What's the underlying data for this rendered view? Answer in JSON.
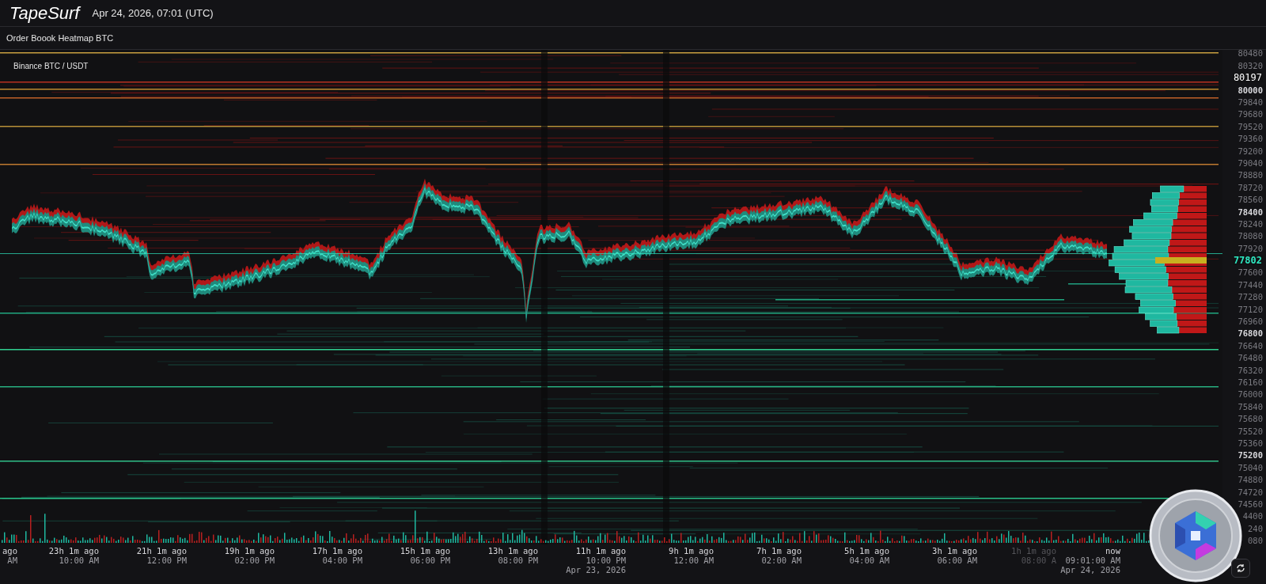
{
  "header": {
    "logo": "TapeSurf",
    "datetime": "Apr 24, 2026, 07:01 (UTC)"
  },
  "title": "Order Boook Heatmap BTC",
  "chart": {
    "pair": "Binance BTC / USDT",
    "y_ticks": [
      {
        "label": "80480",
        "kind": "minor"
      },
      {
        "label": "80320",
        "kind": "minor"
      },
      {
        "label": "80197",
        "kind": "last"
      },
      {
        "label": "80000",
        "kind": "major"
      },
      {
        "label": "79840",
        "kind": "minor"
      },
      {
        "label": "79680",
        "kind": "minor"
      },
      {
        "label": "79520",
        "kind": "minor"
      },
      {
        "label": "79360",
        "kind": "minor"
      },
      {
        "label": "79200",
        "kind": "minor"
      },
      {
        "label": "79040",
        "kind": "minor"
      },
      {
        "label": "78880",
        "kind": "minor"
      },
      {
        "label": "78720",
        "kind": "minor"
      },
      {
        "label": "78560",
        "kind": "minor"
      },
      {
        "label": "78400",
        "kind": "major"
      },
      {
        "label": "78240",
        "kind": "minor"
      },
      {
        "label": "78080",
        "kind": "minor"
      },
      {
        "label": "77920",
        "kind": "minor"
      },
      {
        "label": "77802",
        "kind": "price"
      },
      {
        "label": "77600",
        "kind": "minor"
      },
      {
        "label": "77440",
        "kind": "minor"
      },
      {
        "label": "77280",
        "kind": "minor"
      },
      {
        "label": "77120",
        "kind": "minor"
      },
      {
        "label": "76960",
        "kind": "minor"
      },
      {
        "label": "76800",
        "kind": "major"
      },
      {
        "label": "76640",
        "kind": "minor"
      },
      {
        "label": "76480",
        "kind": "minor"
      },
      {
        "label": "76320",
        "kind": "minor"
      },
      {
        "label": "76160",
        "kind": "minor"
      },
      {
        "label": "76000",
        "kind": "minor"
      },
      {
        "label": "75840",
        "kind": "minor"
      },
      {
        "label": "75680",
        "kind": "minor"
      },
      {
        "label": "75520",
        "kind": "minor"
      },
      {
        "label": "75360",
        "kind": "minor"
      },
      {
        "label": "75200",
        "kind": "major"
      },
      {
        "label": "75040",
        "kind": "minor"
      },
      {
        "label": "74880",
        "kind": "minor"
      },
      {
        "label": "74720",
        "kind": "minor"
      },
      {
        "label": "74560",
        "kind": "minor"
      },
      {
        "label": "4400",
        "kind": "minor"
      },
      {
        "label": "240",
        "kind": "minor"
      },
      {
        "label": "080",
        "kind": "minor"
      }
    ],
    "x_ticks": [
      {
        "ago": "ago",
        "time": "AM",
        "dim": false
      },
      {
        "ago": "23h 1m ago",
        "time": "10:00 AM",
        "dim": false
      },
      {
        "ago": "21h 1m ago",
        "time": "12:00 PM",
        "dim": false
      },
      {
        "ago": "19h 1m ago",
        "time": "02:00 PM",
        "dim": false
      },
      {
        "ago": "17h 1m ago",
        "time": "04:00 PM",
        "dim": false
      },
      {
        "ago": "15h 1m ago",
        "time": "06:00 PM",
        "dim": false
      },
      {
        "ago": "13h 1m ago",
        "time": "08:00 PM",
        "dim": false
      },
      {
        "ago": "11h 1m ago",
        "time": "10:00 PM",
        "date": "Apr 23, 2026",
        "dim": false
      },
      {
        "ago": "9h 1m ago",
        "time": "12:00 AM",
        "dim": false
      },
      {
        "ago": "7h 1m ago",
        "time": "02:00 AM",
        "dim": false
      },
      {
        "ago": "5h 1m ago",
        "time": "04:00 AM",
        "dim": false
      },
      {
        "ago": "3h 1m ago",
        "time": "06:00 AM",
        "dim": false
      },
      {
        "ago": "1h 1m ago",
        "time": "08:00 A",
        "dim": true
      },
      {
        "ago": "now",
        "time": "09:01:00 AM",
        "date": "Apr 24, 2026",
        "dim": false
      }
    ]
  }
}
